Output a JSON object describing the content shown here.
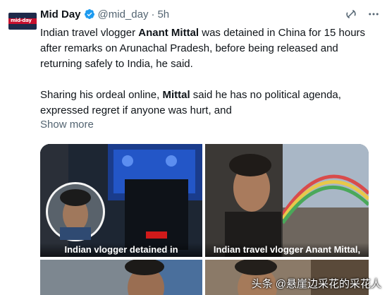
{
  "tweet": {
    "author_name": "Mid Day",
    "handle": "@mid_day",
    "separator": "·",
    "time": "5h",
    "avatar_text": "mid-day",
    "para1_a": "Indian travel vlogger ",
    "para1_bold": "Anant Mittal",
    "para1_b": " was detained in China for 15 hours after remarks on Arunachal Pradesh, before being released and returning safely to India, he said.",
    "para2_a": "Sharing his ordeal online, ",
    "para2_bold": "Mittal",
    "para2_b": " said he has no political agenda, expressed regret if anyone was hurt, and",
    "show_more": "Show more"
  },
  "media": {
    "tile1_caption": "Indian vlogger detained in",
    "tile2_caption": "Indian travel vlogger Anant Mittal,"
  },
  "watermark": "头条 @悬崖边采花的采花人",
  "icons": [
    "verified-badge-icon",
    "grok-icon",
    "more-options-icon"
  ],
  "colors": {
    "text": "#0f1419",
    "secondary": "#536471",
    "verified": "#1d9bf0"
  }
}
